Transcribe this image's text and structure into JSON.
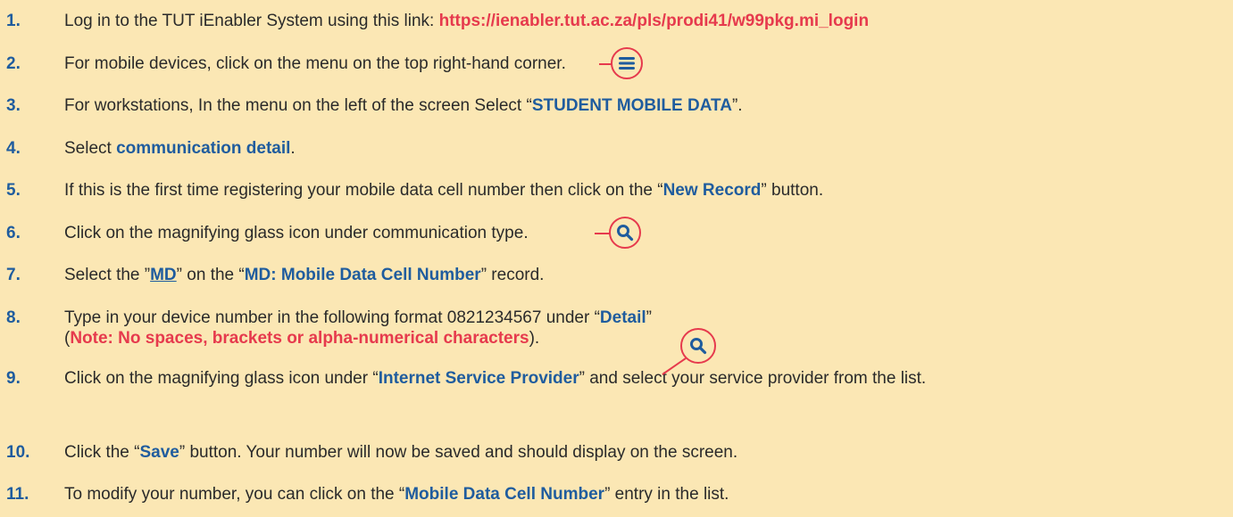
{
  "steps": [
    {
      "num": "1.",
      "t1": "Log in to the TUT iEnabler System using this link: ",
      "link": "https://ienabler.tut.ac.za/pls/prodi41/w99pkg.mi_login"
    },
    {
      "num": "2.",
      "t1": "For mobile devices, click on the menu on the top right-hand corner."
    },
    {
      "num": "3.",
      "t1": "For workstations, In the menu on the left of the screen Select “",
      "b1": "STUDENT MOBILE DATA",
      "t2": "”."
    },
    {
      "num": "4.",
      "t1": "Select ",
      "b1": "communication detail",
      "t2": "."
    },
    {
      "num": "5.",
      "t1": "If this is the first time registering your mobile data cell number then click on the “",
      "b1": "New Record",
      "t2": "” button."
    },
    {
      "num": "6.",
      "t1": "Click on the magnifying glass icon under communication type."
    },
    {
      "num": "7.",
      "t1": "Select the ”",
      "b1": "MD",
      "t2": "” on the “",
      "b2": "MD: Mobile Data Cell Number",
      "t3": "” record."
    },
    {
      "num": "8.",
      "t1": "Type in your device number in the following format 0821234567 under “",
      "b1": "Detail",
      "t2": "”",
      "line2a": "(",
      "r1": "Note: No spaces, brackets or alpha-numerical characters",
      "line2b": ")."
    },
    {
      "num": "9.",
      "t1": "Click on the magnifying glass icon under “",
      "b1": "Internet Service Provider",
      "t2": "” and select your service provider from the list."
    },
    {
      "num": "10.",
      "t1": "Click the “",
      "b1": "Save",
      "t2": "” button. Your number will now be saved and should display on the screen."
    },
    {
      "num": "11.",
      "t1": "To modify your number, you can click on the “",
      "b1": "Mobile Data Cell Number",
      "t2": "” entry in the list."
    }
  ],
  "icons": {
    "menu": "menu-icon",
    "search": "search-icon"
  },
  "colors": {
    "background": "#fbe7b4",
    "blue": "#1f5c9e",
    "red": "#e63a4d",
    "text": "#2a2a2a"
  }
}
